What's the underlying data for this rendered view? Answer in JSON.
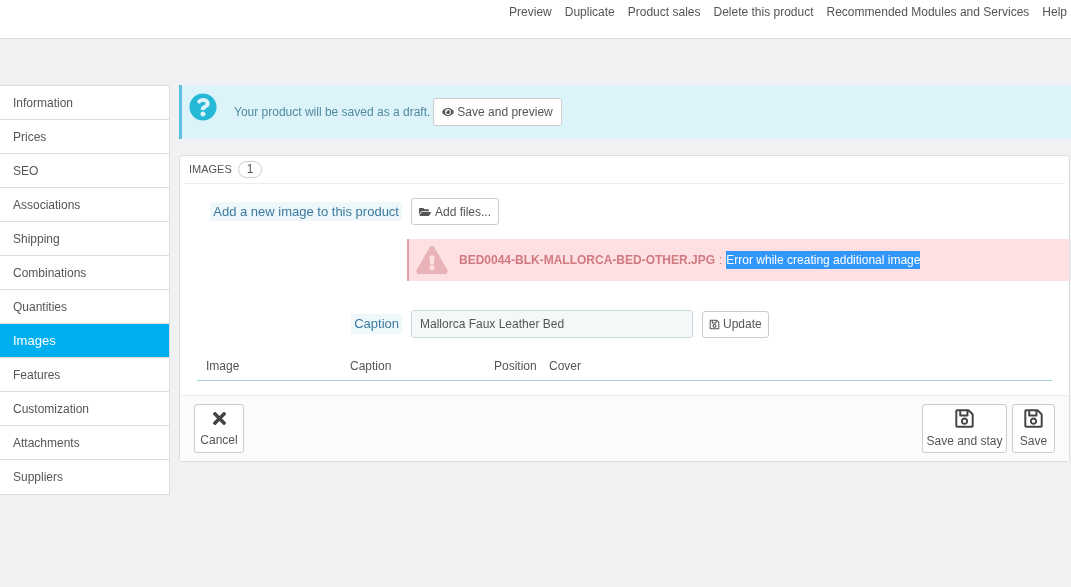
{
  "top_links": [
    "Preview",
    "Duplicate",
    "Product sales",
    "Delete this product",
    "Recommended Modules and Services",
    "Help"
  ],
  "sidebar": {
    "items": [
      {
        "label": "Information",
        "selected": false
      },
      {
        "label": "Prices",
        "selected": false
      },
      {
        "label": "SEO",
        "selected": false
      },
      {
        "label": "Associations",
        "selected": false
      },
      {
        "label": "Shipping",
        "selected": false
      },
      {
        "label": "Combinations",
        "selected": false
      },
      {
        "label": "Quantities",
        "selected": false
      },
      {
        "label": "Images",
        "selected": true
      },
      {
        "label": "Features",
        "selected": false
      },
      {
        "label": "Customization",
        "selected": false
      },
      {
        "label": "Attachments",
        "selected": false
      },
      {
        "label": "Suppliers",
        "selected": false
      }
    ]
  },
  "draft_alert": {
    "text": "Your product will be saved as a draft.",
    "button": "Save and preview"
  },
  "images_panel": {
    "title": "IMAGES",
    "count": "1",
    "add_label": "Add a new image to this product",
    "add_button": "Add files...",
    "error": {
      "file": "BED0044-BLK-MALLORCA-BED-OTHER.JPG",
      "separator": ":",
      "message": "Error while creating additional image",
      "message_selected": true
    },
    "caption_label": "Caption",
    "caption_value": "Mallorca Faux Leather Bed",
    "update_button": "Update",
    "table": {
      "columns": [
        "Image",
        "Caption",
        "Position",
        "Cover"
      ]
    },
    "footer": {
      "cancel": "Cancel",
      "save_and_stay": "Save and stay",
      "save": "Save"
    }
  }
}
